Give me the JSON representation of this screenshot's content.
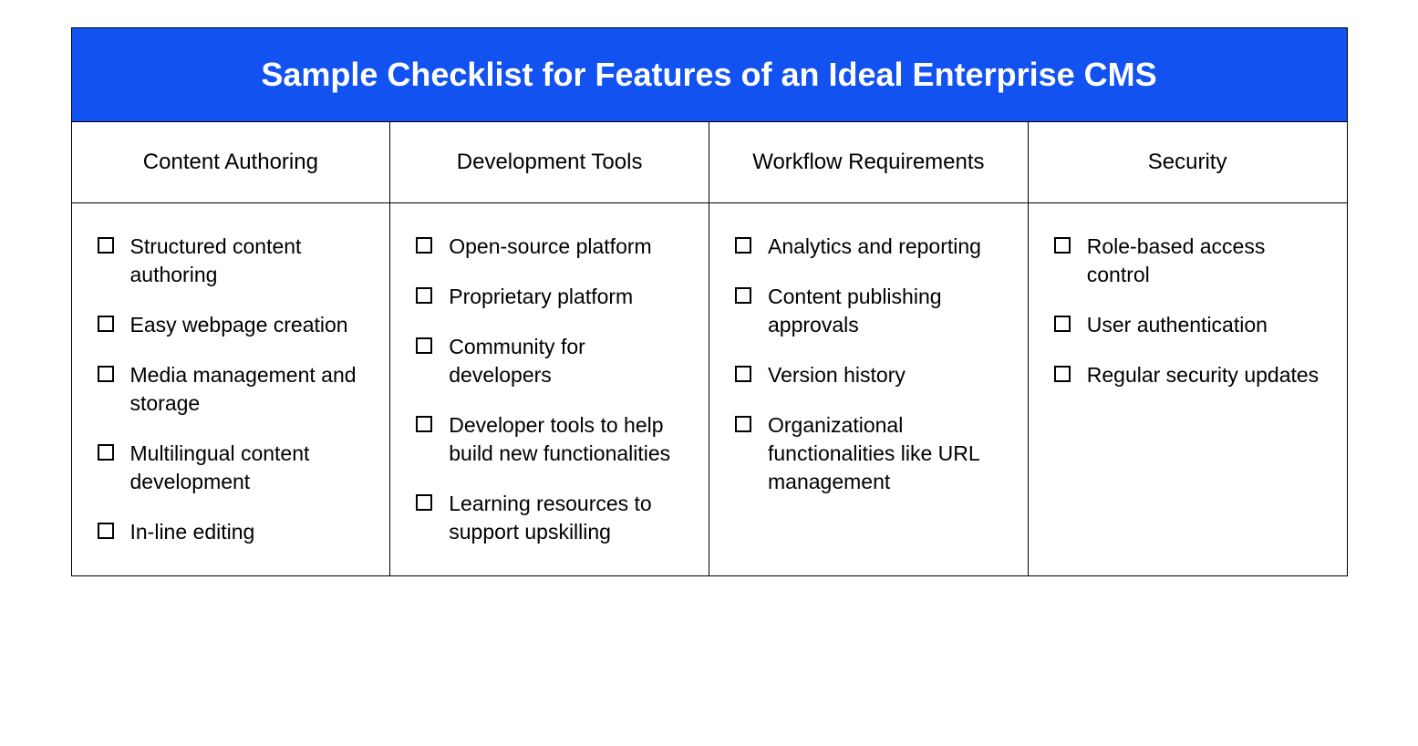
{
  "title": "Sample Checklist for Features of an Ideal Enterprise CMS",
  "columns": [
    {
      "header": "Content Authoring",
      "items": [
        "Structured content authoring",
        "Easy webpage creation",
        "Media management and storage",
        "Multilingual content development",
        "In-line editing"
      ]
    },
    {
      "header": "Development Tools",
      "items": [
        "Open-source platform",
        "Proprietary platform",
        "Community for developers",
        "Developer tools to help build new functionalities",
        "Learning resources to support upskilling"
      ]
    },
    {
      "header": "Workflow Requirements",
      "items": [
        "Analytics and reporting",
        "Content publishing approvals",
        "Version history",
        "Organizational functionalities like URL management"
      ]
    },
    {
      "header": "Security",
      "items": [
        "Role-based access control",
        "User authentication",
        "Regular security updates"
      ]
    }
  ]
}
